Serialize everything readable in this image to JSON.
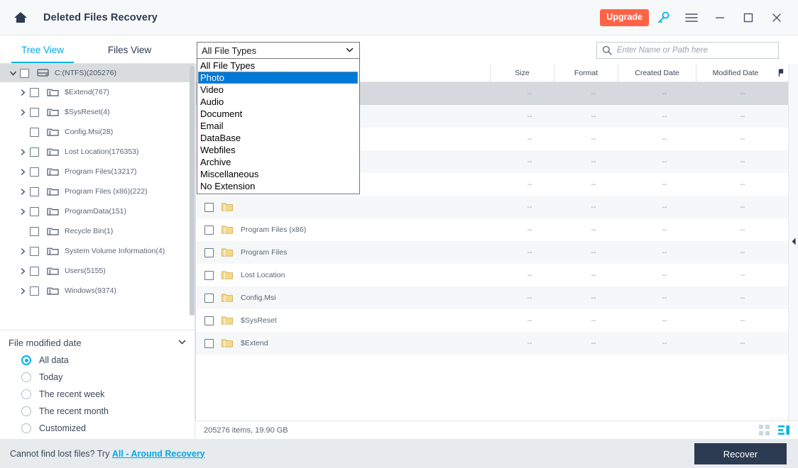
{
  "titlebar": {
    "home_icon": "home-icon",
    "title": "Deleted Files Recovery",
    "upgrade_label": "Upgrade",
    "key_icon": "key-icon",
    "menu_icon": "hamburger-menu-icon",
    "minimize_icon": "minimize-icon",
    "maximize_icon": "maximize-icon",
    "close_icon": "close-icon",
    "accent_orange": "#ff6347",
    "accent_cyan": "#00b3e6",
    "dark_navy": "#2c3a52"
  },
  "tabs": [
    {
      "label": "Tree View",
      "active": true
    },
    {
      "label": "Files View",
      "active": false
    }
  ],
  "filetype_select": {
    "value": "All File Types",
    "expanded": true,
    "caret_icon": "chevron-down-icon",
    "options": [
      "All File Types",
      "Photo",
      "Video",
      "Audio",
      "Document",
      "Email",
      "DataBase",
      "Webfiles",
      "Archive",
      "Miscellaneous",
      "No Extension"
    ],
    "highlighted": "Photo",
    "highlight_color": "#0078d7"
  },
  "search": {
    "placeholder": "Enter Name or Path here",
    "value": "",
    "icon": "search-icon"
  },
  "tree": {
    "root": {
      "label": "C:(NTFS)(205276)",
      "expandable": true,
      "expanded": true,
      "icon": "drive-icon"
    },
    "items": [
      {
        "label": "$Extend(767)",
        "expandable": true
      },
      {
        "label": "$SysReset(4)",
        "expandable": true
      },
      {
        "label": "Config.Msi(28)",
        "expandable": false
      },
      {
        "label": "Lost Location(176353)",
        "expandable": true
      },
      {
        "label": "Program Files(13217)",
        "expandable": true
      },
      {
        "label": "Program Files (x86)(222)",
        "expandable": true
      },
      {
        "label": "ProgramData(151)",
        "expandable": true
      },
      {
        "label": "Recycle Bin(1)",
        "expandable": false
      },
      {
        "label": "System Volume Information(4)",
        "expandable": true
      },
      {
        "label": "Users(5155)",
        "expandable": true
      },
      {
        "label": "Windows(9374)",
        "expandable": true
      }
    ]
  },
  "filter": {
    "title": "File modified date",
    "caret_icon": "chevron-down-icon",
    "options": [
      {
        "label": "All data",
        "selected": true
      },
      {
        "label": "Today",
        "selected": false
      },
      {
        "label": "The recent week",
        "selected": false
      },
      {
        "label": "The recent month",
        "selected": false
      },
      {
        "label": "Customized",
        "selected": false
      }
    ]
  },
  "filelist": {
    "columns": [
      "",
      "Size",
      "Format",
      "Created Date",
      "Modified Date"
    ],
    "sort_icon": "sort-arrow-icon",
    "rows": [
      {
        "name": "",
        "size": "--",
        "format": "--",
        "created": "--",
        "modified": "--",
        "state": "sel"
      },
      {
        "name": "",
        "size": "--",
        "format": "--",
        "created": "--",
        "modified": "--",
        "state": "alt"
      },
      {
        "name": "",
        "size": "--",
        "format": "--",
        "created": "--",
        "modified": "--",
        "state": ""
      },
      {
        "name": "",
        "size": "--",
        "format": "--",
        "created": "--",
        "modified": "--",
        "state": "alt"
      },
      {
        "name": "",
        "size": "--",
        "format": "--",
        "created": "--",
        "modified": "--",
        "state": ""
      },
      {
        "name": "",
        "size": "--",
        "format": "--",
        "created": "--",
        "modified": "--",
        "state": "alt"
      },
      {
        "name": "Program Files (x86)",
        "size": "--",
        "format": "--",
        "created": "--",
        "modified": "--",
        "state": ""
      },
      {
        "name": "Program Files",
        "size": "--",
        "format": "--",
        "created": "--",
        "modified": "--",
        "state": "alt"
      },
      {
        "name": "Lost Location",
        "size": "--",
        "format": "--",
        "created": "--",
        "modified": "--",
        "state": ""
      },
      {
        "name": "Config.Msi",
        "size": "--",
        "format": "--",
        "created": "--",
        "modified": "--",
        "state": "alt"
      },
      {
        "name": "$SysReset",
        "size": "--",
        "format": "--",
        "created": "--",
        "modified": "--",
        "state": ""
      },
      {
        "name": "$Extend",
        "size": "--",
        "format": "--",
        "created": "--",
        "modified": "--",
        "state": "alt"
      }
    ]
  },
  "statusbar": {
    "text": "205276 items, 19.90 GB",
    "grid_view_icon": "grid-view-icon",
    "list_view_icon": "list-view-icon"
  },
  "footer": {
    "text": "Cannot find lost files? Try ",
    "link": "All - Around Recovery",
    "recover_label": "Recover"
  }
}
